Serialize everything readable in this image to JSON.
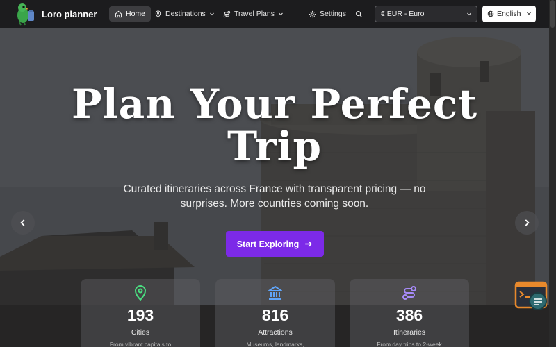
{
  "brand": {
    "name": "Loro planner"
  },
  "nav": {
    "home": "Home",
    "destinations": "Destinations",
    "travel_plans": "Travel Plans",
    "settings": "Settings"
  },
  "currency": {
    "selected": "€ EUR - Euro"
  },
  "language": {
    "selected": "English"
  },
  "hero": {
    "title": "Plan Your Perfect Trip",
    "subtitle": "Curated itineraries across France with transparent pricing — no surprises. More countries coming soon.",
    "cta": "Start Exploring"
  },
  "stats": [
    {
      "value": "193",
      "label": "Cities",
      "desc": "From vibrant capitals to",
      "icon": "map-pin-icon"
    },
    {
      "value": "816",
      "label": "Attractions",
      "desc": "Museums, landmarks,",
      "icon": "landmark-icon"
    },
    {
      "value": "386",
      "label": "Itineraries",
      "desc": "From day trips to 2-week",
      "icon": "route-icon"
    }
  ],
  "colors": {
    "accent": "#7c2ae8",
    "stat_icon_cities": "#4ade80",
    "stat_icon_attractions": "#60a5fa",
    "stat_icon_itineraries": "#a78bfa",
    "navbar": "#1c1c1e"
  }
}
